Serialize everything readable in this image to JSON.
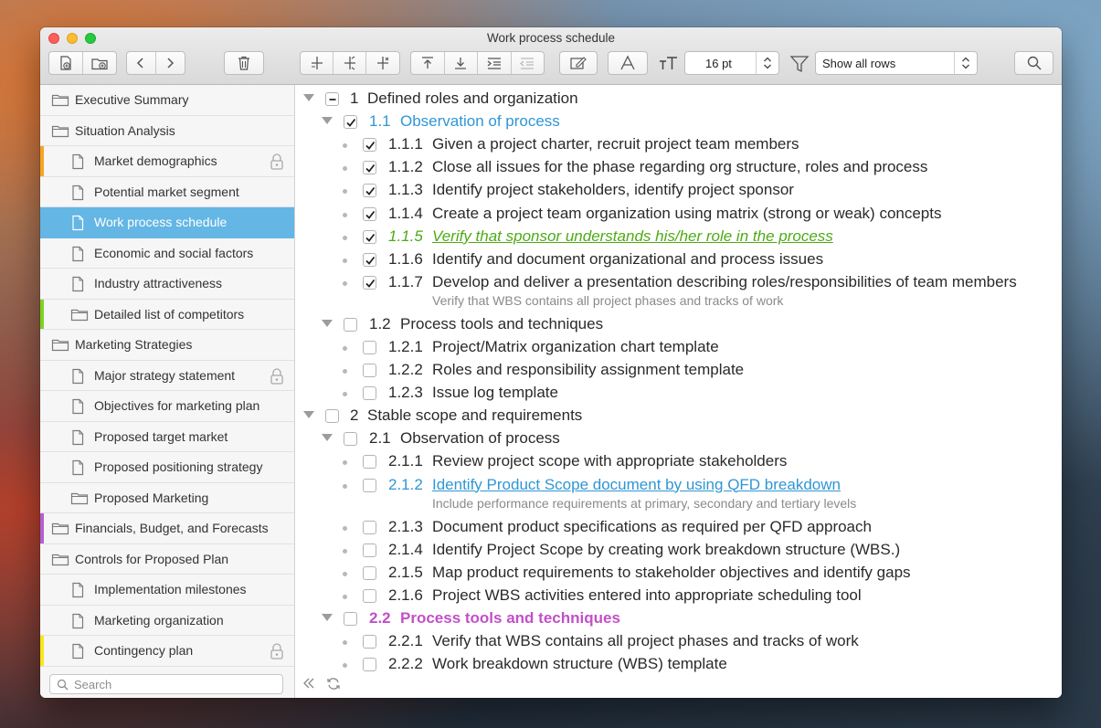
{
  "window": {
    "title": "Work process schedule"
  },
  "toolbar": {
    "font_size": "16 pt",
    "row_filter": "Show all rows"
  },
  "sidebar": {
    "items": [
      {
        "label": "Executive Summary",
        "type": "folder",
        "level": 0
      },
      {
        "label": "Situation Analysis",
        "type": "folder",
        "level": 0
      },
      {
        "label": "Market demographics",
        "type": "page",
        "level": 1,
        "marker": "#f5a623",
        "locked": true
      },
      {
        "label": "Potential market segment",
        "type": "page",
        "level": 1
      },
      {
        "label": "Work process schedule",
        "type": "page",
        "level": 1,
        "selected": true
      },
      {
        "label": "Economic and social factors",
        "type": "page",
        "level": 1
      },
      {
        "label": "Industry attractiveness",
        "type": "page",
        "level": 1
      },
      {
        "label": "Detailed list of competitors",
        "type": "folder",
        "level": 1,
        "marker": "#7ed321"
      },
      {
        "label": "Marketing Strategies",
        "type": "folder",
        "level": 0
      },
      {
        "label": "Major strategy statement",
        "type": "page",
        "level": 1,
        "locked": true
      },
      {
        "label": "Objectives for marketing plan",
        "type": "page",
        "level": 1
      },
      {
        "label": "Proposed target market",
        "type": "page",
        "level": 1
      },
      {
        "label": "Proposed positioning strategy",
        "type": "page",
        "level": 1
      },
      {
        "label": "Proposed Marketing",
        "type": "folder",
        "level": 1
      },
      {
        "label": "Financials, Budget, and Forecasts",
        "type": "folder",
        "level": 0,
        "marker": "#b45fd1"
      },
      {
        "label": "Controls for Proposed Plan",
        "type": "folder",
        "level": 0
      },
      {
        "label": "Implementation milestones",
        "type": "page",
        "level": 1
      },
      {
        "label": "Marketing organization",
        "type": "page",
        "level": 1
      },
      {
        "label": "Contingency plan",
        "type": "page",
        "level": 1,
        "marker": "#f8e71c",
        "locked": true
      }
    ],
    "search_placeholder": "Search"
  },
  "outline": {
    "rows": [
      {
        "num": "1",
        "text": "Defined roles and organization",
        "level": 0,
        "toggle": "expanded",
        "check": "mixed"
      },
      {
        "num": "1.1",
        "text": "Observation of process",
        "level": 1,
        "toggle": "expanded",
        "check": "checked",
        "style": "blue"
      },
      {
        "num": "1.1.1",
        "text": "Given a project charter, recruit project team members",
        "level": 2,
        "check": "checked"
      },
      {
        "num": "1.1.2",
        "text": "Close all issues for the phase regarding org structure, roles and process",
        "level": 2,
        "check": "checked"
      },
      {
        "num": "1.1.3",
        "text": "Identify project stakeholders, identify project sponsor",
        "level": 2,
        "check": "checked"
      },
      {
        "num": "1.1.4",
        "text": "Create a project team organization using matrix (strong or weak) concepts",
        "level": 2,
        "check": "checked"
      },
      {
        "num": "1.1.5",
        "text": "Verify that sponsor understands his/her role in the process",
        "level": 2,
        "check": "checked",
        "style": "green"
      },
      {
        "num": "1.1.6",
        "text": "Identify and document organizational and process issues",
        "level": 2,
        "check": "checked"
      },
      {
        "num": "1.1.7",
        "text": "Develop and deliver a presentation describing roles/responsibilities of team members",
        "level": 2,
        "check": "checked",
        "note": "Verify that WBS contains all project phases and tracks of work"
      },
      {
        "num": "1.2",
        "text": "Process tools and techniques",
        "level": 1,
        "toggle": "expanded",
        "check": "unchecked"
      },
      {
        "num": "1.2.1",
        "text": "Project/Matrix organization chart template",
        "level": 2,
        "check": "unchecked"
      },
      {
        "num": "1.2.2",
        "text": "Roles and responsibility assignment template",
        "level": 2,
        "check": "unchecked"
      },
      {
        "num": "1.2.3",
        "text": "Issue log template",
        "level": 2,
        "check": "unchecked"
      },
      {
        "num": "2",
        "text": "Stable scope and requirements",
        "level": 0,
        "toggle": "expanded",
        "check": "unchecked"
      },
      {
        "num": "2.1",
        "text": "Observation of process",
        "level": 1,
        "toggle": "expanded",
        "check": "unchecked"
      },
      {
        "num": "2.1.1",
        "text": "Review project scope with appropriate stakeholders",
        "level": 2,
        "check": "unchecked"
      },
      {
        "num": "2.1.2",
        "text": "Identify Product Scope document by using QFD breakdown",
        "level": 2,
        "check": "unchecked",
        "style": "link",
        "note": "Include performance requirements at primary, secondary and tertiary levels"
      },
      {
        "num": "2.1.3",
        "text": "Document product specifications as required per QFD approach",
        "level": 2,
        "check": "unchecked"
      },
      {
        "num": "2.1.4",
        "text": "Identify Project Scope by creating work breakdown structure (WBS.)",
        "level": 2,
        "check": "unchecked"
      },
      {
        "num": "2.1.5",
        "text": "Map product requirements to stakeholder objectives and identify gaps",
        "level": 2,
        "check": "unchecked"
      },
      {
        "num": "2.1.6",
        "text": "Project WBS activities entered into appropriate scheduling tool",
        "level": 2,
        "check": "unchecked"
      },
      {
        "num": "2.2",
        "text": "Process tools and techniques",
        "level": 1,
        "toggle": "expanded",
        "check": "unchecked",
        "style": "purple"
      },
      {
        "num": "2.2.1",
        "text": "Verify that WBS contains all project phases and tracks of work",
        "level": 2,
        "check": "unchecked"
      },
      {
        "num": "2.2.2",
        "text": "Work breakdown structure (WBS) template",
        "level": 2,
        "check": "unchecked"
      }
    ]
  }
}
